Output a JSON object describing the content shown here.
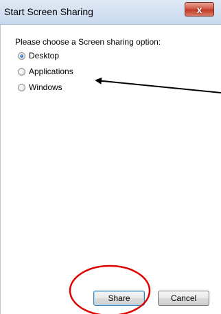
{
  "window": {
    "title": "Start Screen Sharing",
    "close_symbol": "x"
  },
  "dialog": {
    "prompt": "Please choose a Screen sharing option:",
    "options": [
      {
        "label": "Desktop",
        "checked": true
      },
      {
        "label": "Applications",
        "checked": false
      },
      {
        "label": "Windows",
        "checked": false
      }
    ]
  },
  "buttons": {
    "share_label": "Share",
    "cancel_label": "Cancel"
  },
  "colors": {
    "annotation_circle": "#e00000",
    "annotation_arrow": "#000000",
    "titlebar": "#c9d9ee",
    "close_button": "#c23a26"
  },
  "icons": {
    "close": "close-icon"
  }
}
